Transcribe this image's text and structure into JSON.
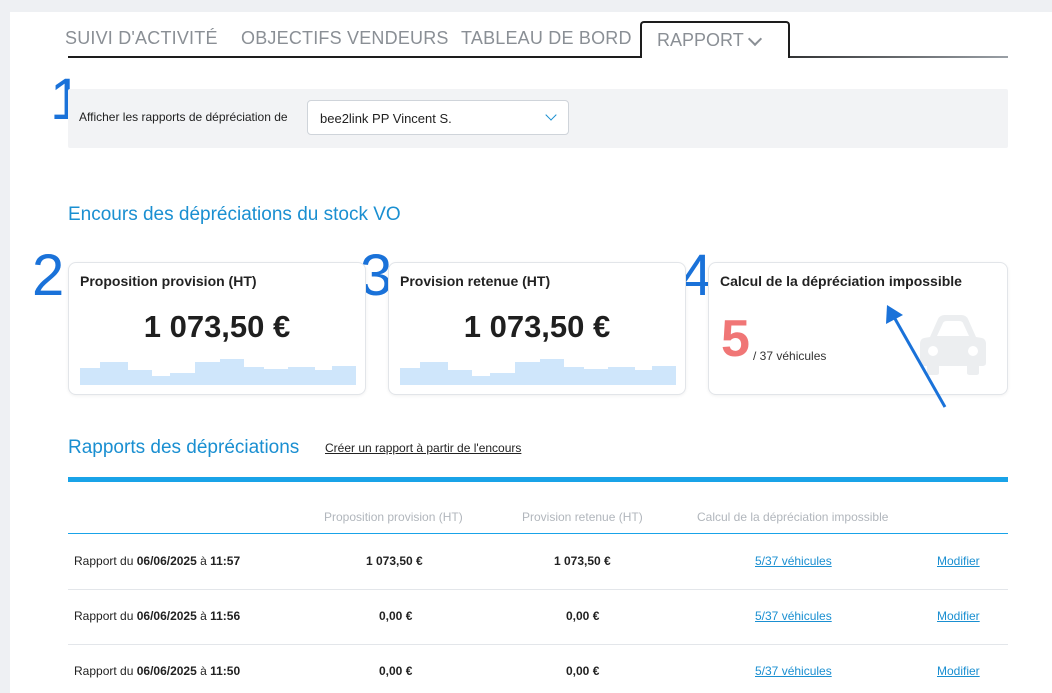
{
  "tabs": {
    "items": [
      "SUIVI D'ACTIVITÉ",
      "OBJECTIFS VENDEURS",
      "TABLEAU DE BORD"
    ],
    "active": "RAPPORT"
  },
  "annotations": [
    "1",
    "2",
    "3",
    "4"
  ],
  "filter": {
    "label": "Afficher les rapports de dépréciation de",
    "selected": "bee2link PP Vincent S."
  },
  "encours": {
    "title": "Encours des dépréciations du stock VO",
    "cards": [
      {
        "title": "Proposition provision (HT)",
        "amount": "1 073,50 €"
      },
      {
        "title": "Provision retenue (HT)",
        "amount": "1 073,50 €"
      },
      {
        "title": "Calcul de la dépréciation impossible",
        "count": "5",
        "total": "/  37  véhicules"
      }
    ]
  },
  "rapports": {
    "title": "Rapports des dépréciations",
    "create_link": "Créer un rapport à partir de l'encours",
    "columns": [
      "Proposition provision (HT)",
      "Provision retenue (HT)",
      "Calcul de la dépréciation impossible"
    ],
    "rows": [
      {
        "prefix": "Rapport du ",
        "date": "06/06/2025",
        "sep": " à ",
        "time": "11:57",
        "proposition": "1 073,50 €",
        "retenue": "1 073,50 €",
        "impossible": "5/37 véhicules",
        "action": "Modifier"
      },
      {
        "prefix": "Rapport du ",
        "date": "06/06/2025",
        "sep": " à ",
        "time": "11:56",
        "proposition": "0,00 €",
        "retenue": "0,00 €",
        "impossible": "5/37 véhicules",
        "action": "Modifier"
      },
      {
        "prefix": "Rapport du ",
        "date": "06/06/2025",
        "sep": " à ",
        "time": "11:50",
        "proposition": "0,00 €",
        "retenue": "0,00 €",
        "impossible": "5/37 véhicules",
        "action": "Modifier"
      }
    ]
  },
  "colors": {
    "accent": "#1a8fd1",
    "annotation": "#1a72d9",
    "count_red": "#f07676",
    "sparkline": "#cfe6fb"
  },
  "icons": [
    "chevron-down-icon",
    "car-icon",
    "sparkline-chart",
    "annotation-arrow"
  ]
}
